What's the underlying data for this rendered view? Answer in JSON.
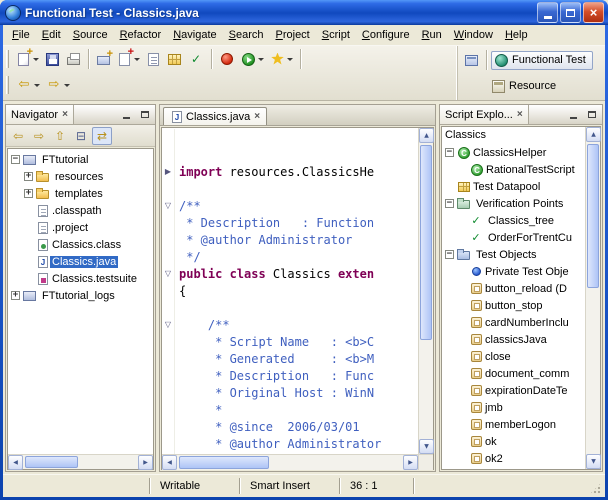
{
  "colors": {
    "selection": "#316AC5",
    "titlebar_top": "#2E6BE6",
    "titlebar_bottom": "#0C43AE",
    "keyword": "#7F0055",
    "comment": "#3F5FBF",
    "record_red": "#D42A10",
    "run_green": "#1E8E1E"
  },
  "window": {
    "title": "Functional Test - Classics.java"
  },
  "menubar": {
    "items": [
      "File",
      "Edit",
      "Source",
      "Refactor",
      "Navigate",
      "Search",
      "Project",
      "Script",
      "Configure",
      "Run",
      "Window",
      "Help"
    ]
  },
  "toolbar": {
    "row1": [
      {
        "name": "new-wizard",
        "icon": "new",
        "dropdown": true
      },
      {
        "name": "save",
        "icon": "save"
      },
      {
        "name": "print",
        "icon": "print"
      },
      {
        "sep": true
      },
      {
        "name": "new-functional-test-project",
        "icon": "project-new"
      },
      {
        "name": "new-functional-test-script",
        "icon": "script-new",
        "dropdown": true
      },
      {
        "name": "new-empty-script",
        "icon": "script-empty"
      },
      {
        "name": "new-test-datapool",
        "icon": "datapool"
      },
      {
        "name": "insert-verification-point",
        "icon": "vp"
      },
      {
        "sep": true
      },
      {
        "name": "record-script",
        "icon": "record"
      },
      {
        "name": "run-script",
        "icon": "run",
        "dropdown": true
      },
      {
        "name": "insert-recording",
        "icon": "star",
        "dropdown": true
      },
      {
        "sep": true
      }
    ],
    "row2": [
      {
        "name": "back",
        "icon": "back",
        "dropdown": true
      },
      {
        "name": "forward",
        "icon": "forward",
        "dropdown": true
      }
    ]
  },
  "perspectives": [
    {
      "label": "Functional Test",
      "active": true
    },
    {
      "label": "Resource",
      "active": false
    }
  ],
  "navigator": {
    "title": "Navigator",
    "toolbar": [
      {
        "name": "back",
        "glyph": "⇦"
      },
      {
        "name": "forward",
        "glyph": "⇨"
      },
      {
        "name": "up",
        "glyph": "⇧"
      },
      {
        "name": "collapse-all",
        "glyph": "⊟"
      },
      {
        "name": "link-with-editor",
        "glyph": "⇄",
        "pressed": true
      }
    ],
    "tree": [
      {
        "label": "FTtutorial",
        "depth": 0,
        "expander": "minus",
        "icon": "project"
      },
      {
        "label": "resources",
        "depth": 1,
        "expander": "plus",
        "icon": "folder"
      },
      {
        "label": "templates",
        "depth": 1,
        "expander": "plus",
        "icon": "folder"
      },
      {
        "label": ".classpath",
        "depth": 1,
        "expander": "none",
        "icon": "file"
      },
      {
        "label": ".project",
        "depth": 1,
        "expander": "none",
        "icon": "file"
      },
      {
        "label": "Classics.class",
        "depth": 1,
        "expander": "none",
        "icon": "class-file"
      },
      {
        "label": "Classics.java",
        "depth": 1,
        "expander": "none",
        "icon": "java-file",
        "selected": true
      },
      {
        "label": "Classics.testsuite",
        "depth": 1,
        "expander": "none",
        "icon": "testsuite"
      },
      {
        "label": "FTtutorial_logs",
        "depth": 0,
        "expander": "plus",
        "icon": "project"
      }
    ]
  },
  "editor": {
    "tab": "Classics.java",
    "lines": [
      {
        "segments": []
      },
      {
        "segments": []
      },
      {
        "fold": "collapsed",
        "segments": [
          {
            "t": "import",
            "c": "keyword"
          },
          {
            "t": " resources.ClassicsHe",
            "c": "plain"
          }
        ]
      },
      {
        "segments": []
      },
      {
        "fold": "expanded",
        "segments": [
          {
            "t": "/**",
            "c": "comment"
          }
        ]
      },
      {
        "segments": [
          {
            "t": " * Description   : Function",
            "c": "comment"
          }
        ]
      },
      {
        "segments": [
          {
            "t": " * @author Administrator",
            "c": "comment"
          }
        ]
      },
      {
        "segments": [
          {
            "t": " */",
            "c": "comment"
          }
        ]
      },
      {
        "fold": "expanded",
        "segments": [
          {
            "t": "public class",
            "c": "keyword"
          },
          {
            "t": " Classics ",
            "c": "plain"
          },
          {
            "t": "exten",
            "c": "keyword"
          }
        ]
      },
      {
        "segments": [
          {
            "t": "{",
            "c": "plain"
          }
        ]
      },
      {
        "segments": []
      },
      {
        "fold": "expanded",
        "segments": [
          {
            "t": "    /**",
            "c": "comment"
          }
        ]
      },
      {
        "segments": [
          {
            "t": "     * Script Name   : <b>C",
            "c": "comment"
          }
        ]
      },
      {
        "segments": [
          {
            "t": "     * Generated     : <b>M",
            "c": "comment"
          }
        ]
      },
      {
        "segments": [
          {
            "t": "     * Description   : Func",
            "c": "comment"
          }
        ]
      },
      {
        "segments": [
          {
            "t": "     * Original Host : WinN",
            "c": "comment"
          }
        ]
      },
      {
        "segments": [
          {
            "t": "     *",
            "c": "comment"
          }
        ]
      },
      {
        "segments": [
          {
            "t": "     * @since  2006/03/01",
            "c": "comment"
          }
        ]
      },
      {
        "segments": [
          {
            "t": "     * @author Administrator",
            "c": "comment"
          }
        ]
      },
      {
        "segments": [
          {
            "t": "     */",
            "c": "comment"
          }
        ]
      }
    ]
  },
  "script_explorer": {
    "title": "Script Explo...",
    "root": "Classics",
    "tree": [
      {
        "label": "ClassicsHelper",
        "depth": 0,
        "expander": "minus",
        "icon": "class-green"
      },
      {
        "label": "RationalTestScript",
        "depth": 1,
        "expander": "none",
        "icon": "class-green"
      },
      {
        "label": "Test Datapool",
        "depth": 0,
        "expander": "none",
        "icon": "datapool"
      },
      {
        "label": "Verification Points",
        "depth": 0,
        "expander": "minus",
        "icon": "vp-group"
      },
      {
        "label": "Classics_tree",
        "depth": 1,
        "expander": "none",
        "icon": "vp-check"
      },
      {
        "label": "OrderForTrentCu",
        "depth": 1,
        "expander": "none",
        "icon": "vp-check"
      },
      {
        "label": "Test Objects",
        "depth": 0,
        "expander": "minus",
        "icon": "obj-group"
      },
      {
        "label": "Private Test Obje",
        "depth": 1,
        "expander": "none",
        "icon": "obj-private"
      },
      {
        "label": "button_reload (D",
        "depth": 1,
        "expander": "none",
        "icon": "test-object"
      },
      {
        "label": "button_stop",
        "depth": 1,
        "expander": "none",
        "icon": "test-object"
      },
      {
        "label": "cardNumberInclu",
        "depth": 1,
        "expander": "none",
        "icon": "test-object"
      },
      {
        "label": "classicsJava",
        "depth": 1,
        "expander": "none",
        "icon": "test-object"
      },
      {
        "label": "close",
        "depth": 1,
        "expander": "none",
        "icon": "test-object"
      },
      {
        "label": "document_comm",
        "depth": 1,
        "expander": "none",
        "icon": "test-object"
      },
      {
        "label": "expirationDateTe",
        "depth": 1,
        "expander": "none",
        "icon": "test-object"
      },
      {
        "label": "jmb",
        "depth": 1,
        "expander": "none",
        "icon": "test-object"
      },
      {
        "label": "memberLogon",
        "depth": 1,
        "expander": "none",
        "icon": "test-object"
      },
      {
        "label": "ok",
        "depth": 1,
        "expander": "none",
        "icon": "test-object"
      },
      {
        "label": "ok2",
        "depth": 1,
        "expander": "none",
        "icon": "test-object"
      }
    ]
  },
  "statusbar": {
    "writable": "Writable",
    "insert_mode": "Smart Insert",
    "position": "36 : 1"
  }
}
